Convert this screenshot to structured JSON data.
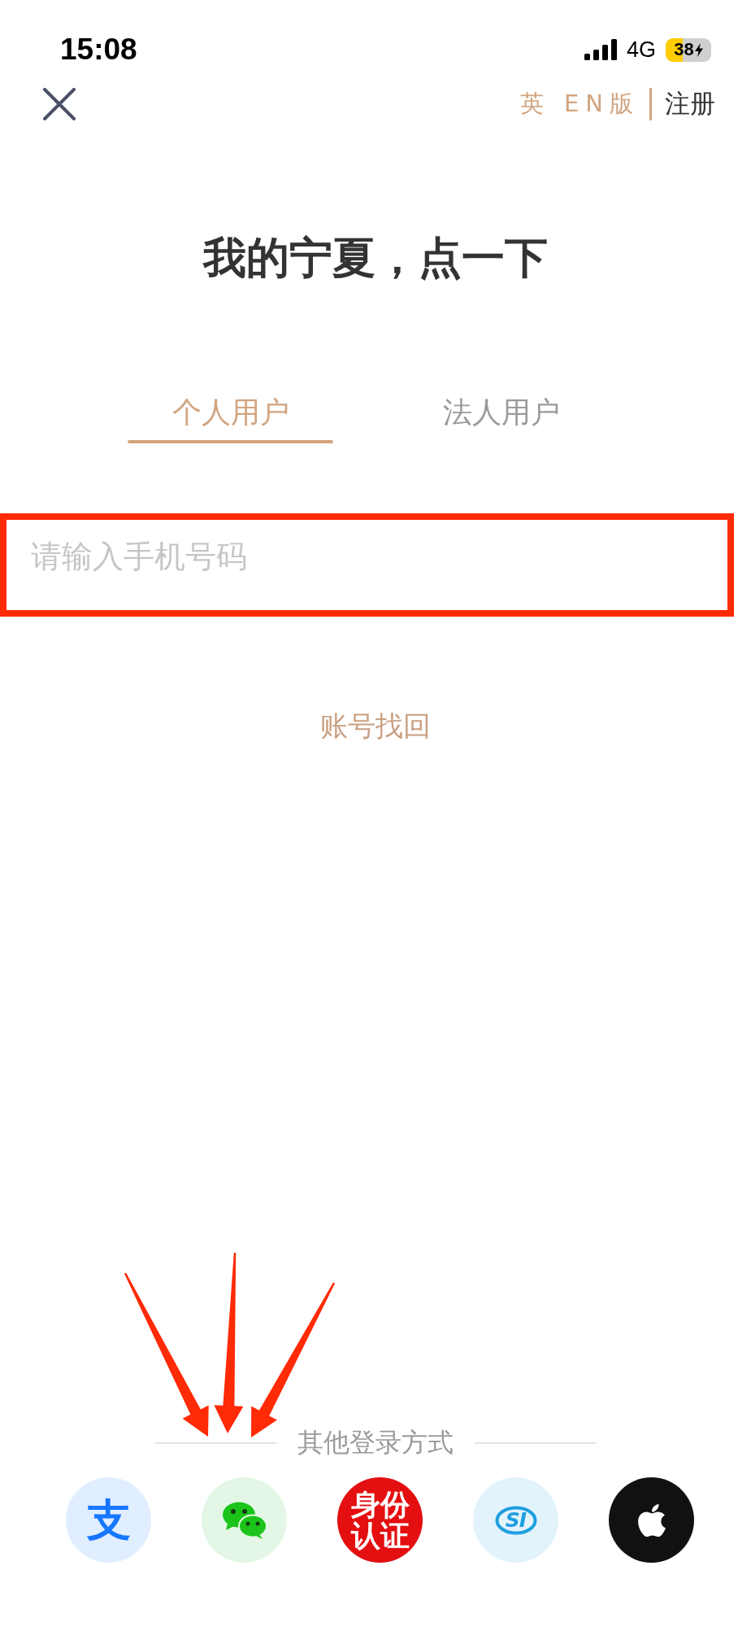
{
  "status_bar": {
    "time": "15:08",
    "network": "4G",
    "battery": "38",
    "charging": true,
    "low_power_mode": true
  },
  "nav_bar": {
    "language_switch": "英 EN版",
    "register": "注册"
  },
  "title": "我的宁夏，点一下",
  "tabs": [
    {
      "label": "个人用户",
      "selected": true
    },
    {
      "label": "法人用户",
      "selected": false
    }
  ],
  "phone_field": {
    "placeholder": "请输入手机号码",
    "highlighted": true
  },
  "recover_link": "账号找回",
  "other_login": {
    "label": "其他登录方式",
    "methods": [
      {
        "kind": "glyph",
        "label": "支"
      },
      {
        "kind": "chat_bubbles"
      },
      {
        "kind": "seal",
        "label": "身份认证"
      },
      {
        "kind": "ring_logo",
        "label": "SI"
      },
      {
        "kind": "apple"
      }
    ]
  },
  "annotation_arrows": [
    {
      "kind": "left"
    },
    {
      "kind": "middle"
    },
    {
      "kind": "right"
    }
  ]
}
